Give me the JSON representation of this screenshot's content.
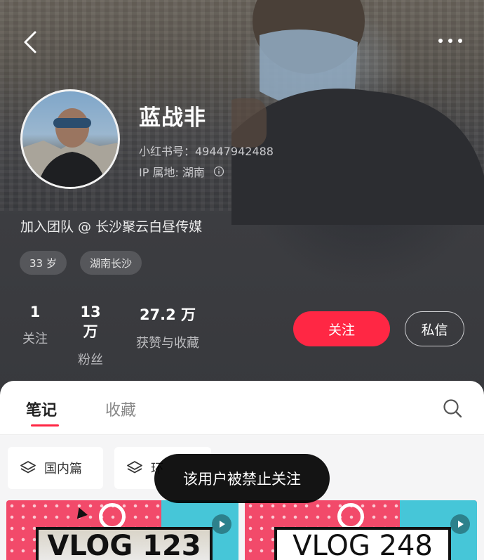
{
  "profile": {
    "name": "蓝战非",
    "xhs_id": "小红书号：4944794248​8",
    "ip_location": "IP 属地: 湖南",
    "bio": "加入团队 @ 长沙聚云白昼传媒",
    "tags": [
      "33 岁",
      "湖南长沙"
    ]
  },
  "stats": [
    {
      "value": "1",
      "label": "关注"
    },
    {
      "value": "13 万",
      "label": "粉丝"
    },
    {
      "value": "27.2 万",
      "label": "获赞与收藏"
    }
  ],
  "actions": {
    "follow_label": "关注",
    "message_label": "私信"
  },
  "tabs": [
    {
      "label": "笔记",
      "active": true
    },
    {
      "label": "收藏",
      "active": false
    }
  ],
  "collections": [
    {
      "label": "国内篇",
      "icon": "layers-icon"
    },
    {
      "label": "环",
      "icon": "layers-icon"
    }
  ],
  "toast": "该用户被禁止关注",
  "cards": [
    {
      "title": "VLOG 123"
    },
    {
      "title": "VLOG 248"
    }
  ],
  "colors": {
    "accent": "#ff2744",
    "header_bg": "#3c3d41"
  }
}
